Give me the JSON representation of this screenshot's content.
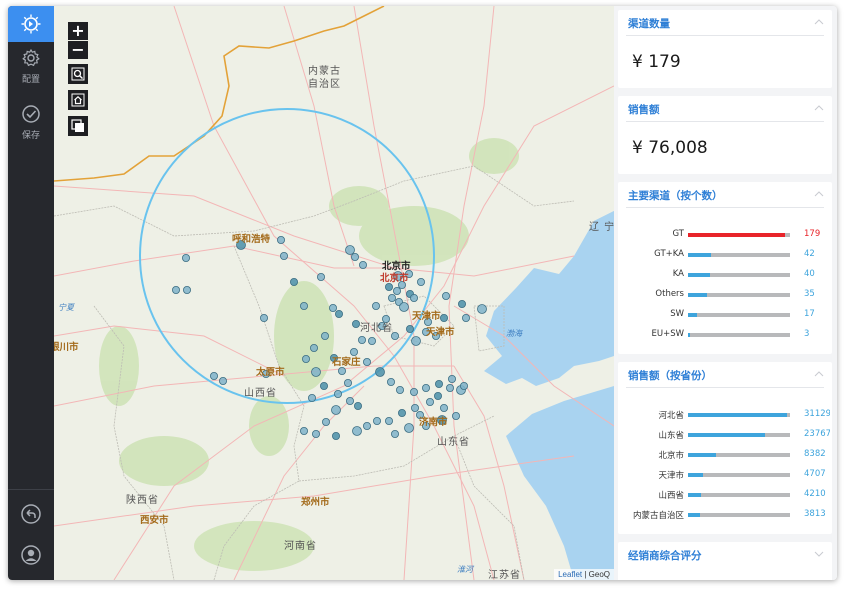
{
  "sidebar": {
    "logo_icon": "logo-icon",
    "items": [
      {
        "label": "配置",
        "icon": "gear-icon"
      },
      {
        "label": "保存",
        "icon": "check-circle-icon"
      }
    ],
    "bottom": [
      {
        "icon": "back-icon"
      },
      {
        "icon": "user-icon"
      }
    ]
  },
  "map": {
    "controls": {
      "zoom_in": "+",
      "zoom_out": "−"
    },
    "places": {
      "nmg": "内蒙古\n自治区",
      "liao": "辽  宁",
      "huhehaote": "呼和浩特",
      "beijing": "北京市",
      "beijing_ctr": "北京市",
      "tianjin_a": "天津市",
      "tianjin_b": "天津市",
      "hebei": "河北省",
      "shijiazhuang": "石家庄",
      "taiyuan": "太原市",
      "shanxi": "山西省",
      "jinan": "济南市",
      "shandong": "山东省",
      "bohai": "渤海",
      "ningxia": "宁夏",
      "yinchuan": "银川市",
      "shaanxi": "陕西省",
      "xian": "西安市",
      "zhengzhou": "郑州市",
      "henan": "河南省",
      "jiangsu": "江苏省",
      "huaihe": "淮河"
    },
    "attribution": {
      "leaflet": "Leaflet",
      "sep": " | ",
      "geoq": "GeoQ"
    },
    "accent": "#69c3ee"
  },
  "panel": {
    "channels": {
      "title": "渠道数量",
      "value": "¥ 179"
    },
    "sales": {
      "title": "销售额",
      "value": "¥ 76,008"
    },
    "main_channels": {
      "title": "主要渠道（按个数）",
      "rows": [
        {
          "label": "GT",
          "value": "179",
          "ratio": 0.95,
          "color": "#e8242a"
        },
        {
          "label": "GT+KA",
          "value": "42",
          "ratio": 0.23,
          "color": "#3ea4dc"
        },
        {
          "label": "KA",
          "value": "40",
          "ratio": 0.22,
          "color": "#3ea4dc"
        },
        {
          "label": "Others",
          "value": "35",
          "ratio": 0.19,
          "color": "#3ea4dc"
        },
        {
          "label": "SW",
          "value": "17",
          "ratio": 0.09,
          "color": "#3ea4dc"
        },
        {
          "label": "EU+SW",
          "value": "3",
          "ratio": 0.02,
          "color": "#3ea4dc"
        }
      ]
    },
    "sales_province": {
      "title": "销售额（按省份）",
      "rows": [
        {
          "label": "河北省",
          "value": "31129",
          "ratio": 0.97
        },
        {
          "label": "山东省",
          "value": "23767",
          "ratio": 0.75
        },
        {
          "label": "北京市",
          "value": "8382",
          "ratio": 0.27
        },
        {
          "label": "天津市",
          "value": "4707",
          "ratio": 0.15
        },
        {
          "label": "山西省",
          "value": "4210",
          "ratio": 0.13
        },
        {
          "label": "内蒙古自治区",
          "value": "3813",
          "ratio": 0.12
        }
      ]
    },
    "dealer_score": {
      "title": "经销商综合评分"
    }
  }
}
